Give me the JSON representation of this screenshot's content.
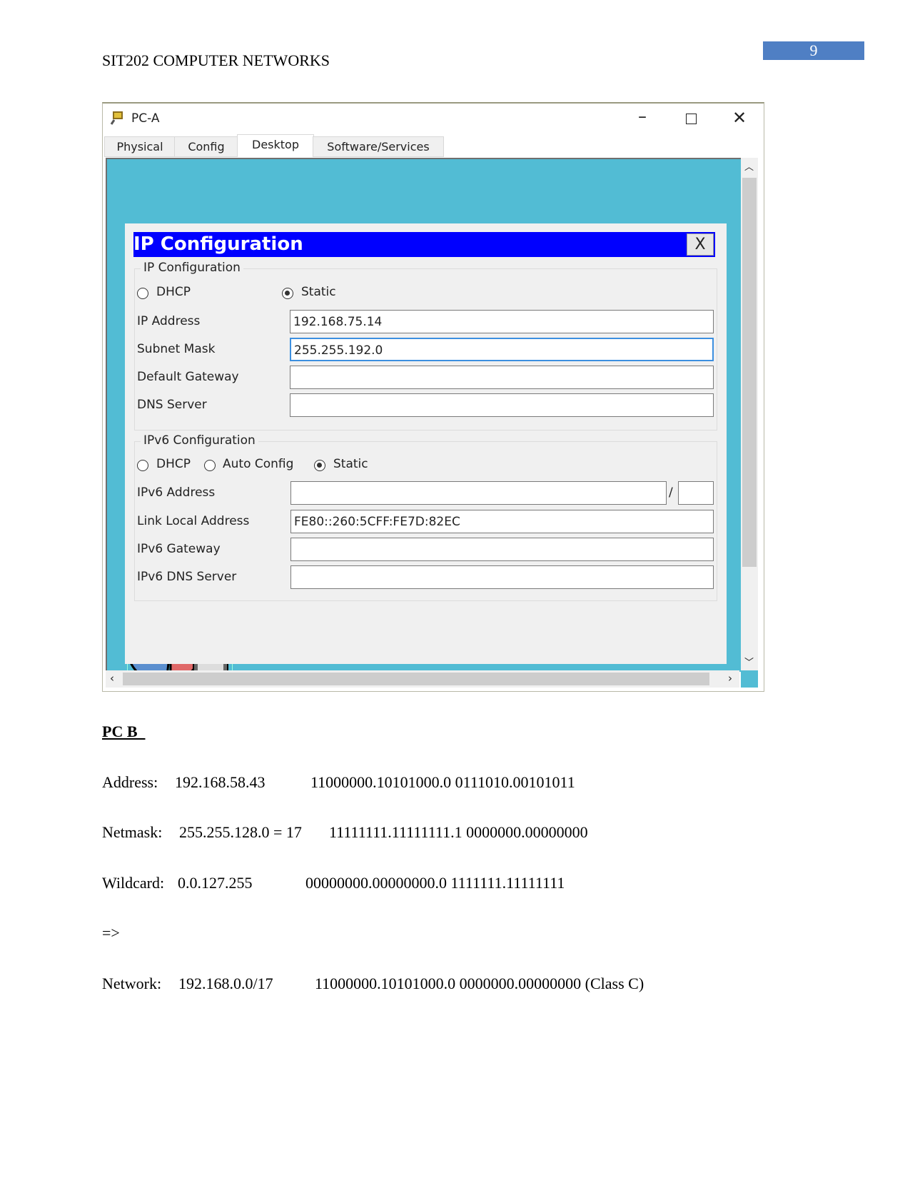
{
  "header": {
    "title": "SIT202 COMPUTER NETWORKS",
    "page_number": "9"
  },
  "window": {
    "title": "PC-A",
    "tabs": [
      {
        "label": "Physical"
      },
      {
        "label": "Config"
      },
      {
        "label": "Desktop",
        "active": true
      },
      {
        "label": "Software/Services"
      }
    ],
    "dialog": {
      "title": "IP Configuration",
      "close_label": "X",
      "ipv4": {
        "legend": "IP Configuration",
        "dhcp_label": "DHCP",
        "static_label": "Static",
        "mode": "Static",
        "ip_label": "IP Address",
        "ip_value": "192.168.75.14",
        "mask_label": "Subnet Mask",
        "mask_value": "255.255.192.0",
        "gateway_label": "Default Gateway",
        "gateway_value": "",
        "dns_label": "DNS Server",
        "dns_value": ""
      },
      "ipv6": {
        "legend": "IPv6 Configuration",
        "dhcp_label": "DHCP",
        "auto_label": "Auto Config",
        "static_label": "Static",
        "mode": "Static",
        "address_label": "IPv6 Address",
        "address_value": "",
        "slash": "/",
        "prefix_value": "",
        "link_local_label": "Link Local Address",
        "link_local_value": "FE80::260:5CFF:FE7D:82EC",
        "gateway_label": "IPv6 Gateway",
        "gateway_value": "",
        "dns_label": "IPv6 DNS Server",
        "dns_value": ""
      }
    },
    "colors": {
      "desktop": "#52bcd4",
      "dialog_title": "#0000ff"
    }
  },
  "body": {
    "heading": "PC B",
    "lines": [
      {
        "label": "Address:",
        "value": "192.168.58.43",
        "binary": "11000000.10101000.0 0111010.00101011"
      },
      {
        "label": "Netmask:",
        "value": "255.255.128.0 = 17",
        "binary": "11111111.11111111.1 0000000.00000000"
      },
      {
        "label": "Wildcard:",
        "value": "0.0.127.255",
        "binary": "00000000.00000000.0 1111111.11111111"
      },
      {
        "label": "=>",
        "value": "",
        "binary": ""
      },
      {
        "label": "Network:",
        "value": "192.168.0.0/17",
        "binary": "11000000.10101000.0 0000000.00000000 (Class C)"
      }
    ]
  }
}
